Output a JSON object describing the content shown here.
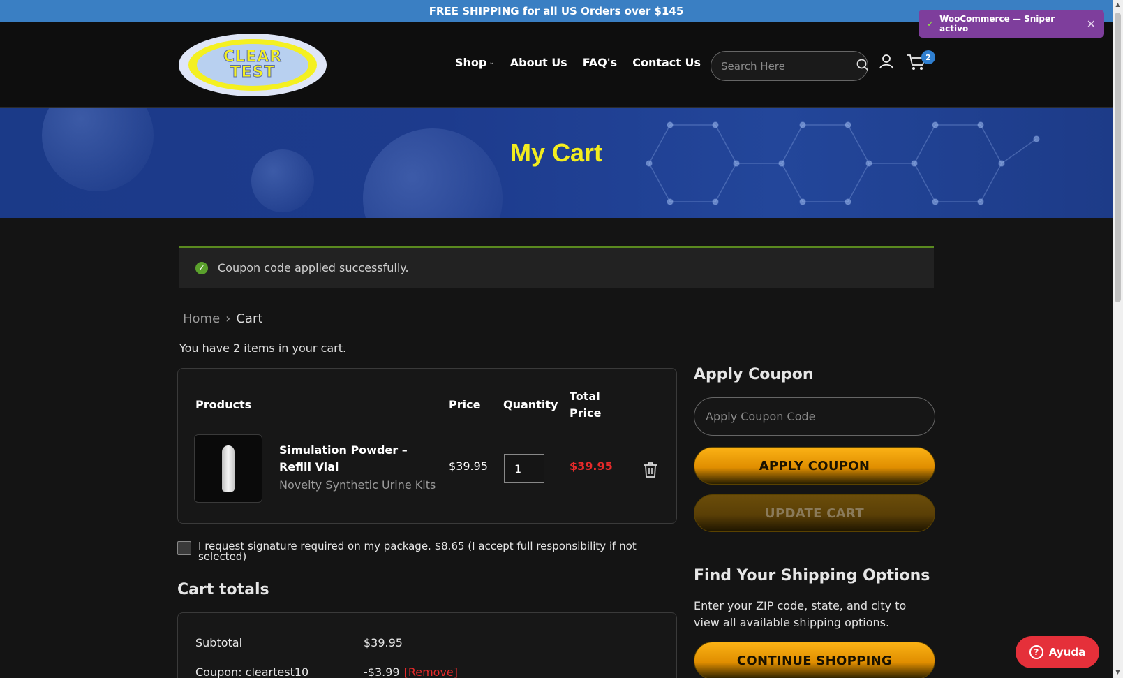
{
  "topbar": {
    "text": "FREE SHIPPING for all US Orders over $145"
  },
  "logo": {
    "line1": "CLEAR",
    "line2": "TEST"
  },
  "nav": {
    "shop": "Shop",
    "about": "About Us",
    "faq": "FAQ's",
    "contact": "Contact Us"
  },
  "search": {
    "placeholder": "Search Here"
  },
  "cart_badge": "2",
  "toast": {
    "text": "WooCommerce — Sniper activo"
  },
  "hero": {
    "title": "My Cart"
  },
  "notice": {
    "text": "Coupon code applied successfully."
  },
  "breadcrumb": {
    "home": "Home",
    "current": "Cart"
  },
  "cart": {
    "count_text": "You have 2 items in your cart.",
    "headers": {
      "products": "Products",
      "price": "Price",
      "quantity": "Quantity",
      "total_line1": "Total",
      "total_line2": "Price"
    },
    "item": {
      "name": "Simulation Powder – Refill Vial",
      "category": "Novelty Synthetic Urine Kits",
      "price": "$39.95",
      "qty": "1",
      "total": "$39.95"
    }
  },
  "signature": {
    "text": "I request signature required on my package. $8.65 (I accept full responsibility if not selected)"
  },
  "totals": {
    "title": "Cart totals",
    "subtotal_label": "Subtotal",
    "subtotal_value": "$39.95",
    "coupon_label": "Coupon: cleartest10",
    "coupon_value": "-$3.99",
    "remove": "[Remove]"
  },
  "coupon": {
    "title": "Apply Coupon",
    "placeholder": "Apply Coupon Code",
    "apply": "APPLY COUPON",
    "update": "UPDATE CART"
  },
  "shipping": {
    "title": "Find Your Shipping Options",
    "desc": "Enter your ZIP code, state, and city to view all available shipping options.",
    "continue": "CONTINUE SHOPPING"
  },
  "help": {
    "label": "Ayuda"
  },
  "colors": {
    "accent_gold": "#fbb215",
    "hero_title": "#f2ec1f",
    "price_red": "#e62a2a",
    "topbar_blue": "#3a7fc3",
    "toast_purple": "#7e3e9c"
  }
}
